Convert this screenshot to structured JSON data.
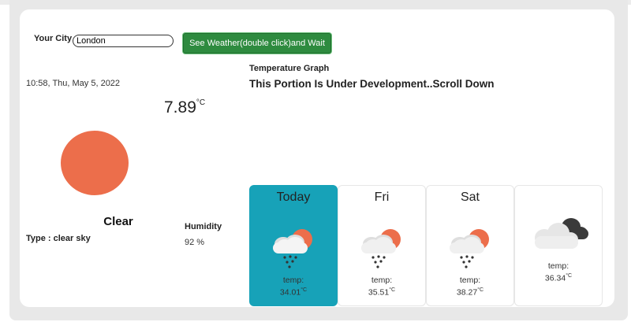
{
  "search": {
    "label": "Your City",
    "value": "London",
    "button_label": "See Weather(double click)and Wait"
  },
  "current": {
    "datetime": "10:58, Thu, May 5, 2022",
    "temperature": "7.89",
    "unit": "°C",
    "condition": "Clear",
    "type": "Type : clear sky",
    "humidity_label": "Humidity",
    "humidity_value": "92 %"
  },
  "graph": {
    "label": "Temperature Graph",
    "note": "This Portion Is Under Development..Scroll Down"
  },
  "forecast": [
    {
      "day": "Today",
      "temp_label": "temp:",
      "temp": "34.01",
      "unit": "°C",
      "icon": "rain-sun-icon"
    },
    {
      "day": "Fri",
      "temp_label": "temp:",
      "temp": "35.51",
      "unit": "°C",
      "icon": "rain-sun-icon"
    },
    {
      "day": "Sat",
      "temp_label": "temp:",
      "temp": "38.27",
      "unit": "°C",
      "icon": "rain-sun-icon"
    },
    {
      "day": "",
      "temp_label": "temp:",
      "temp": "36.34",
      "unit": "°C",
      "icon": "cloudy-icon"
    }
  ],
  "colors": {
    "accent": "#17a2b8",
    "button": "#2e8b3f",
    "sun": "#ec6e4b"
  }
}
